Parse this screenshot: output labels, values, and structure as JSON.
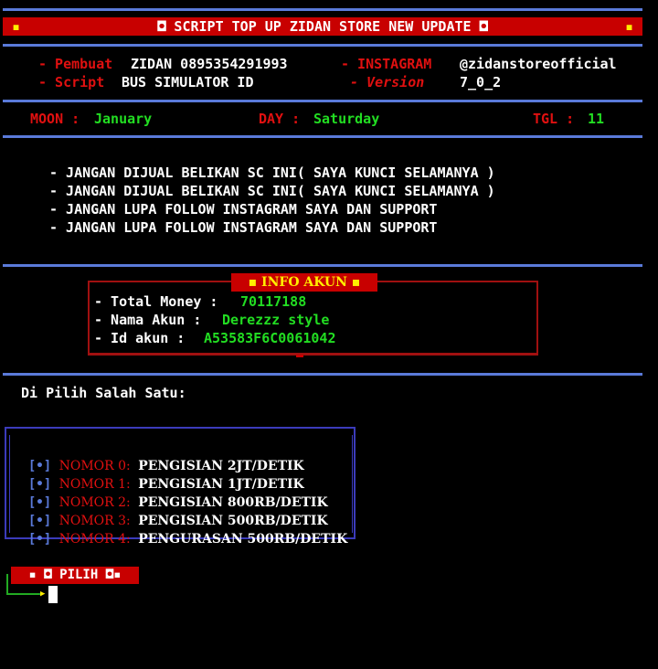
{
  "header": {
    "title": "◘ SCRIPT TOP UP ZIDAN STORE NEW UPDATE ◘",
    "bullet": "▪"
  },
  "info": {
    "pembuat_label": "- Pembuat",
    "pembuat_value": "ZIDAN 0895354291993",
    "instagram_label": "- INSTAGRAM",
    "instagram_value": "@zidanstoreofficial",
    "script_label": "- Script",
    "script_value": "BUS SIMULATOR ID",
    "version_label": "- Version",
    "version_value": "7_0_2"
  },
  "date": {
    "moon_label": "MOON :",
    "moon_value": "January",
    "day_label": "DAY :",
    "day_value": "Saturday",
    "tgl_label": "TGL :",
    "tgl_value": "11"
  },
  "notices": [
    "- JANGAN DIJUAL BELIKAN SC INI( SAYA KUNCI SELAMANYA )",
    "- JANGAN DIJUAL BELIKAN SC INI( SAYA KUNCI SELAMANYA )",
    "- JANGAN LUPA FOLLOW INSTAGRAM SAYA DAN SUPPORT",
    "- JANGAN LUPA FOLLOW INSTAGRAM SAYA DAN SUPPORT"
  ],
  "account": {
    "heading": "▪ INFO AKUN ▪",
    "money_label": "- Total Money :",
    "money_value": "70117188",
    "name_label": "- Nama Akun :",
    "name_value": "Derezzz style",
    "id_label": "- Id akun :",
    "id_value": "A53583F6C0061042"
  },
  "prompt_choose": "Di Pilih Salah Satu:",
  "menu": [
    {
      "bracket": "[•]",
      "num": "NOMOR 0:",
      "desc": "PENGISIAN 2JT/DETIK"
    },
    {
      "bracket": "[•]",
      "num": "NOMOR 1:",
      "desc": "PENGISIAN 1JT/DETIK"
    },
    {
      "bracket": "[•]",
      "num": "NOMOR 2:",
      "desc": "PENGISIAN 800RB/DETIK"
    },
    {
      "bracket": "[•]",
      "num": "NOMOR 3:",
      "desc": "PENGISIAN 500RB/DETIK"
    },
    {
      "bracket": "[•]",
      "num": "NOMOR 4:",
      "desc": "PENGURASAN 500RB/DETIK"
    }
  ],
  "pilih": "▪ ◘ PILIH ◘▪"
}
